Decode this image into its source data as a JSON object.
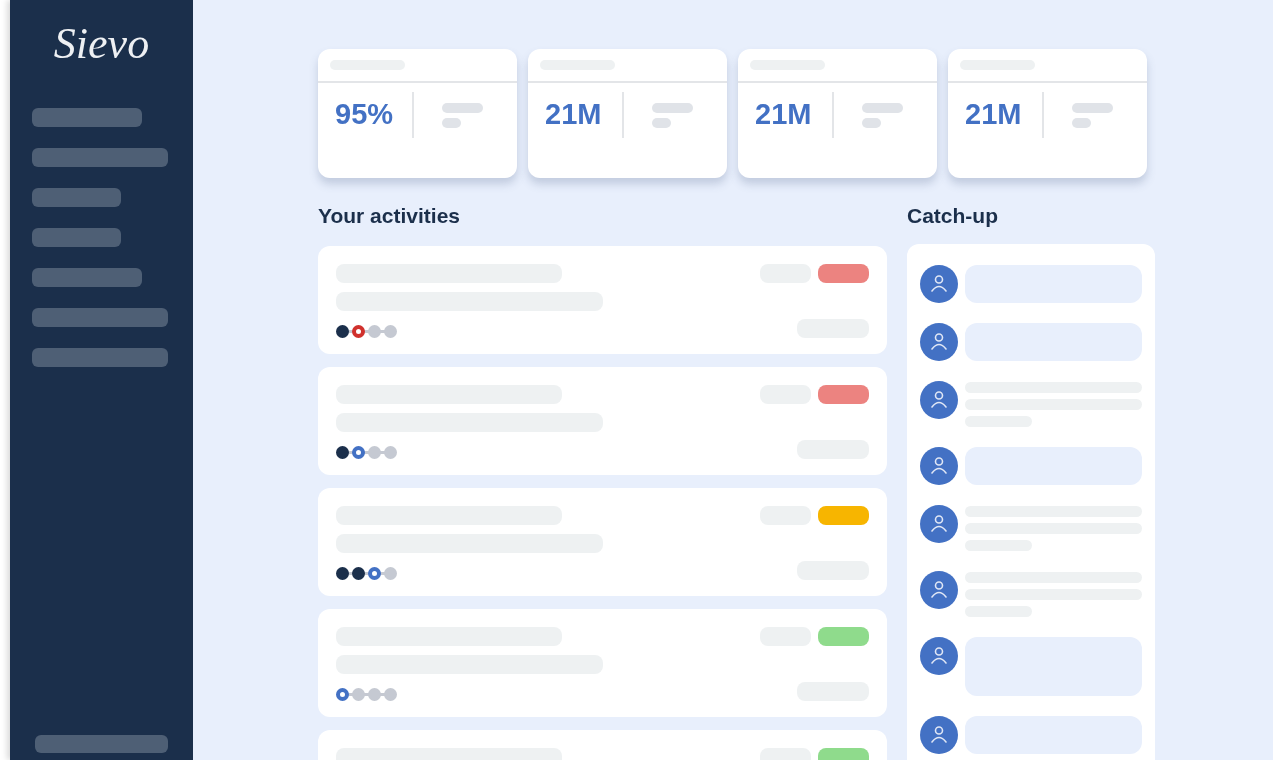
{
  "logo": "Sievo",
  "stats": [
    {
      "value": "95%"
    },
    {
      "value": "21M"
    },
    {
      "value": "21M"
    },
    {
      "value": "21M"
    }
  ],
  "activities": {
    "title": "Your activities",
    "items": [
      {
        "color": "#ec8380",
        "steps": [
          {
            "kind": "done"
          },
          {
            "kind": "warning"
          },
          {
            "kind": "todo"
          },
          {
            "kind": "todo"
          }
        ]
      },
      {
        "color": "#ec8380",
        "steps": [
          {
            "kind": "done"
          },
          {
            "kind": "current"
          },
          {
            "kind": "todo"
          },
          {
            "kind": "todo"
          }
        ]
      },
      {
        "color": "#f7b500",
        "steps": [
          {
            "kind": "done"
          },
          {
            "kind": "done"
          },
          {
            "kind": "current"
          },
          {
            "kind": "todo"
          }
        ]
      },
      {
        "color": "#8fdb8c",
        "steps": [
          {
            "kind": "current"
          },
          {
            "kind": "todo"
          },
          {
            "kind": "todo"
          },
          {
            "kind": "todo"
          }
        ]
      },
      {
        "color": "#8fdb8c"
      }
    ]
  },
  "catch_up": {
    "title": "Catch-up",
    "items": [
      {
        "kind": "bubble"
      },
      {
        "kind": "bubble"
      },
      {
        "kind": "lines"
      },
      {
        "kind": "bubble"
      },
      {
        "kind": "lines"
      },
      {
        "kind": "lines"
      },
      {
        "kind": "tall-bubble"
      },
      {
        "kind": "bubble"
      }
    ]
  }
}
